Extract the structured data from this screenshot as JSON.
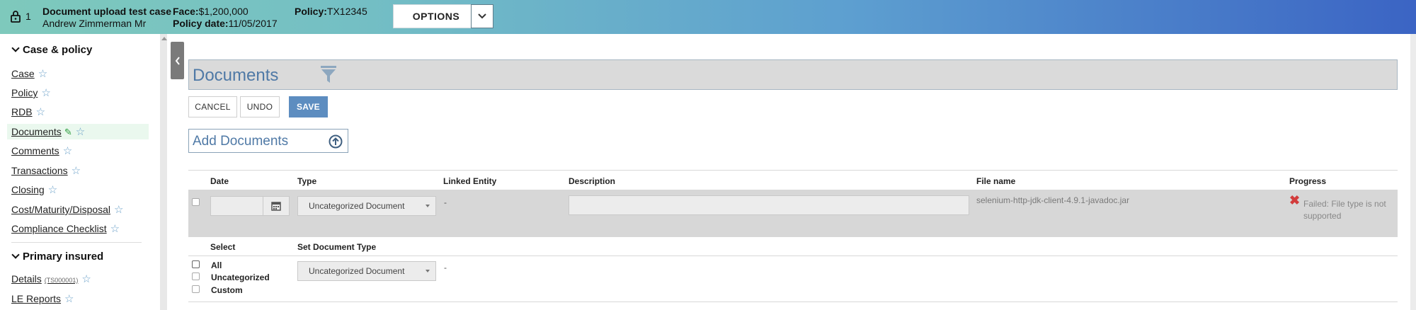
{
  "header": {
    "case_number": "1",
    "case_title": "Document upload test case",
    "case_owner": "Andrew Zimmerman Mr",
    "face_label": "Face:",
    "face_value": "$1,200,000",
    "policy_date_label": "Policy date:",
    "policy_date_value": "11/05/2017",
    "policy_label": "Policy:",
    "policy_value": "TX12345",
    "options_label": "OPTIONS"
  },
  "sidebar": {
    "sections": [
      {
        "title": "Case & policy",
        "items": [
          {
            "label": "Case"
          },
          {
            "label": "Policy"
          },
          {
            "label": "RDB"
          },
          {
            "label": "Documents"
          },
          {
            "label": "Comments"
          },
          {
            "label": "Transactions"
          },
          {
            "label": "Closing"
          },
          {
            "label": "Cost/Maturity/Disposal"
          },
          {
            "label": "Compliance Checklist"
          }
        ]
      },
      {
        "title": "Primary insured",
        "items": [
          {
            "label": "Details",
            "tag": "(TS000001)"
          },
          {
            "label": "LE Reports"
          }
        ]
      }
    ]
  },
  "main": {
    "title": "Documents",
    "buttons": {
      "cancel": "CANCEL",
      "undo": "UNDO",
      "save": "SAVE"
    },
    "add_documents": "Add Documents",
    "table": {
      "headers": {
        "date": "Date",
        "type": "Type",
        "linked_entity": "Linked Entity",
        "description": "Description",
        "file_name": "File name",
        "progress": "Progress"
      },
      "row": {
        "date": "",
        "type": "Uncategorized Document",
        "linked_entity": "-",
        "description": "",
        "file_name": "selenium-http-jdk-client-4.9.1-javadoc.jar",
        "progress": "Failed: File type is not supported"
      }
    },
    "bulk": {
      "select_header": "Select",
      "set_type_header": "Set Document Type",
      "options": [
        "All",
        "Uncategorized",
        "Custom"
      ],
      "type_value": "Uncategorized Document",
      "linked_entity": "-"
    }
  },
  "colors": {
    "accent": "#4f79a6",
    "save_button": "#5d8dc0",
    "error": "#d23c3c",
    "header_gradient_start": "#7ec9bc",
    "header_gradient_end": "#3b64c4"
  },
  "icons": [
    "lock-icon",
    "chevron-down-icon",
    "star-icon",
    "pencil-icon",
    "chevron-left-icon",
    "filter-icon",
    "upload-icon",
    "calendar-icon",
    "error-x-icon"
  ]
}
